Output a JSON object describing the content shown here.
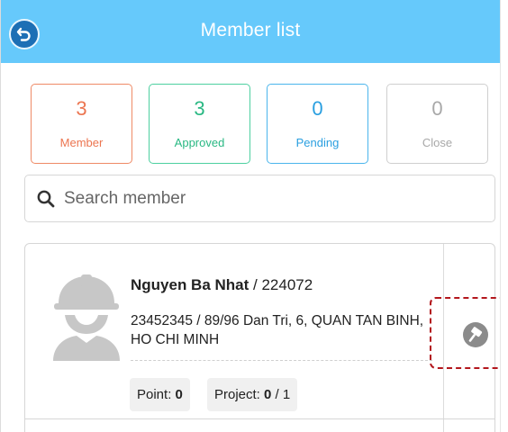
{
  "header": {
    "title": "Member list",
    "back_icon": "back-arrow-icon",
    "bg_color": "#66c9fb"
  },
  "stats": [
    {
      "count": "3",
      "label": "Member",
      "color": "#ec7550"
    },
    {
      "count": "3",
      "label": "Approved",
      "color": "#29b883"
    },
    {
      "count": "0",
      "label": "Pending",
      "color": "#2a9fe0"
    },
    {
      "count": "0",
      "label": "Close",
      "color": "#a8a8a8"
    }
  ],
  "search": {
    "placeholder": "Search member",
    "value": "",
    "icon": "search-icon"
  },
  "members": [
    {
      "name": "Nguyen Ba Nhat",
      "id_sep": " / ",
      "id": "224072",
      "address": "23452345 / 89/96 Dan Tri, 6, QUAN TAN BINH, HO CHI MINH",
      "point_label": "Point: ",
      "point_value": "0",
      "project_label": "Project: ",
      "project_value": "0",
      "project_total": " / 1",
      "avatar_icon": "worker-helmet-icon",
      "action_icon": "edit-brush-icon"
    }
  ],
  "highlight_color": "#b3171d"
}
